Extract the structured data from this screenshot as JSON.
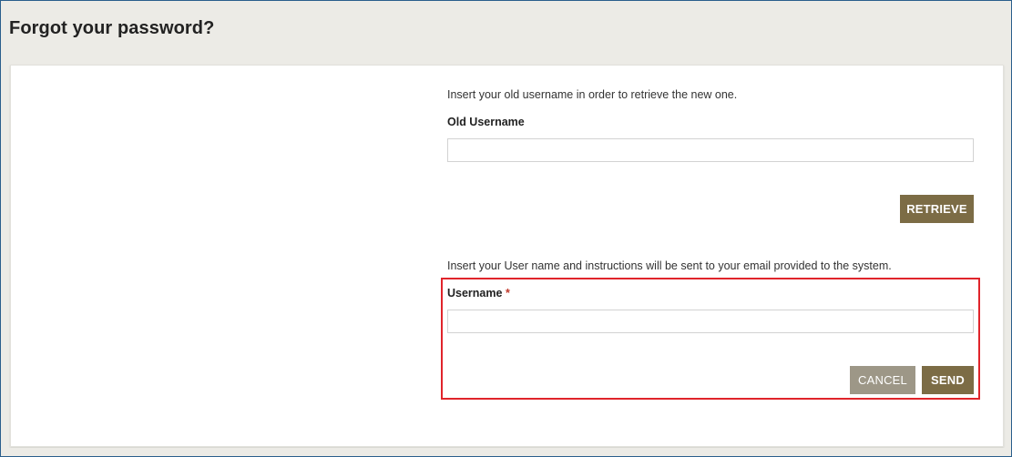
{
  "page": {
    "title": "Forgot your password?"
  },
  "retrieve_section": {
    "instruction": "Insert your old username in order to retrieve the new one.",
    "label": "Old Username",
    "input_value": "",
    "input_placeholder": "",
    "button_label": "RETRIEVE"
  },
  "reset_section": {
    "instruction": "Insert your User name and instructions will be sent to your email provided to the system.",
    "label": "Username",
    "required_marker": "*",
    "input_value": "",
    "input_placeholder": "",
    "cancel_label": "CANCEL",
    "send_label": "SEND"
  },
  "colors": {
    "primary_button": "#7c6c45",
    "secondary_button": "#9d9787",
    "highlight": "#e0242b",
    "background": "#ecebe6"
  }
}
